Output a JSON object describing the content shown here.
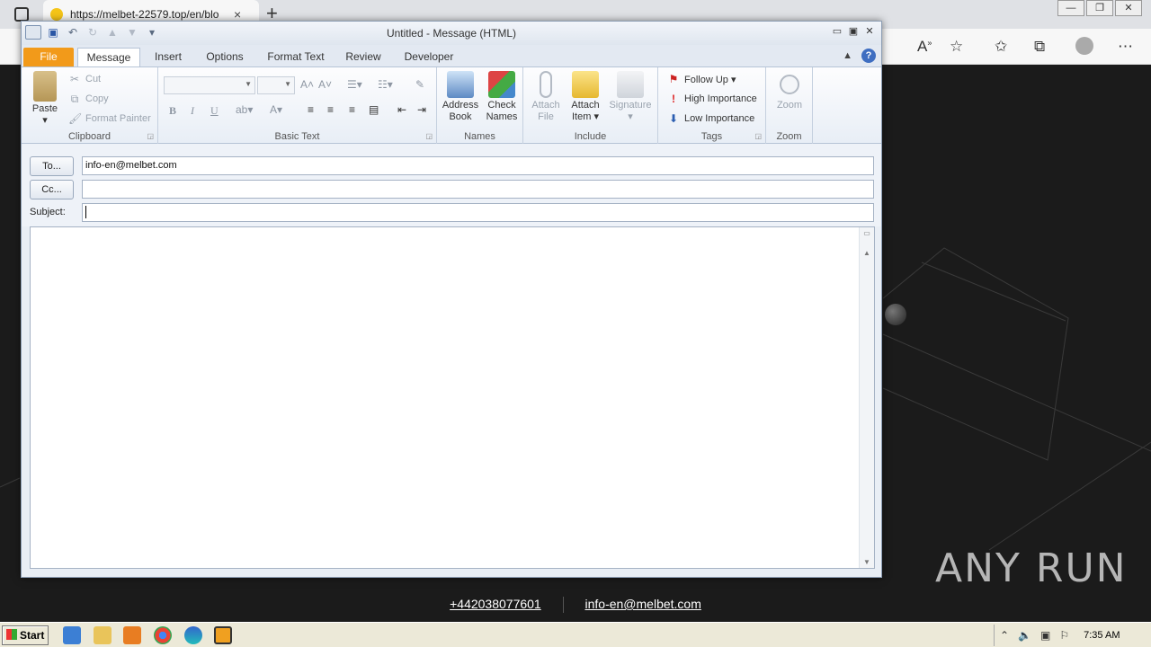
{
  "browser": {
    "tab_title": "https://melbet-22579.top/en/blo",
    "close_glyph": "×",
    "new_tab_glyph": "+",
    "icons": [
      "read-aloud-icon",
      "add-favorite-icon",
      "favorites-icon",
      "collections-icon",
      "profile-icon",
      "more-icon"
    ]
  },
  "outlook": {
    "title": "Untitled  -  Message (HTML)",
    "tabs": [
      "File",
      "Message",
      "Insert",
      "Options",
      "Format Text",
      "Review",
      "Developer"
    ],
    "active_tab": "Message",
    "help_glyph": "?",
    "ribbon": {
      "clipboard": {
        "label": "Clipboard",
        "paste": "Paste",
        "cut": "Cut",
        "copy": "Copy",
        "format_painter": "Format Painter"
      },
      "basic_text": {
        "label": "Basic Text",
        "bold": "B",
        "italic": "I",
        "underline": "U"
      },
      "names": {
        "label": "Names",
        "address_book_l1": "Address",
        "address_book_l2": "Book",
        "check_names_l1": "Check",
        "check_names_l2": "Names"
      },
      "include": {
        "label": "Include",
        "attach_file_l1": "Attach",
        "attach_file_l2": "File",
        "attach_item_l1": "Attach",
        "attach_item_l2": "Item ▾",
        "signature": "Signature"
      },
      "tags": {
        "label": "Tags",
        "follow_up": "Follow Up ▾",
        "high_importance": "High Importance",
        "low_importance": "Low Importance"
      },
      "zoom": {
        "label": "Zoom",
        "zoom": "Zoom"
      }
    },
    "fields": {
      "to_button": "To...",
      "to_value": "info-en@melbet.com",
      "cc_button": "Cc...",
      "cc_value": "",
      "subject_label": "Subject:",
      "subject_value": ""
    }
  },
  "page": {
    "phone": "+442038077601",
    "email": "info-en@melbet.com",
    "watermark": "ANY RUN"
  },
  "taskbar": {
    "start": "Start",
    "clock": "7:35 AM"
  },
  "colors": {
    "file_tab": "#f29a1a",
    "ribbon_bg": "#e8eef6",
    "page_bg": "#1b1b1b"
  }
}
